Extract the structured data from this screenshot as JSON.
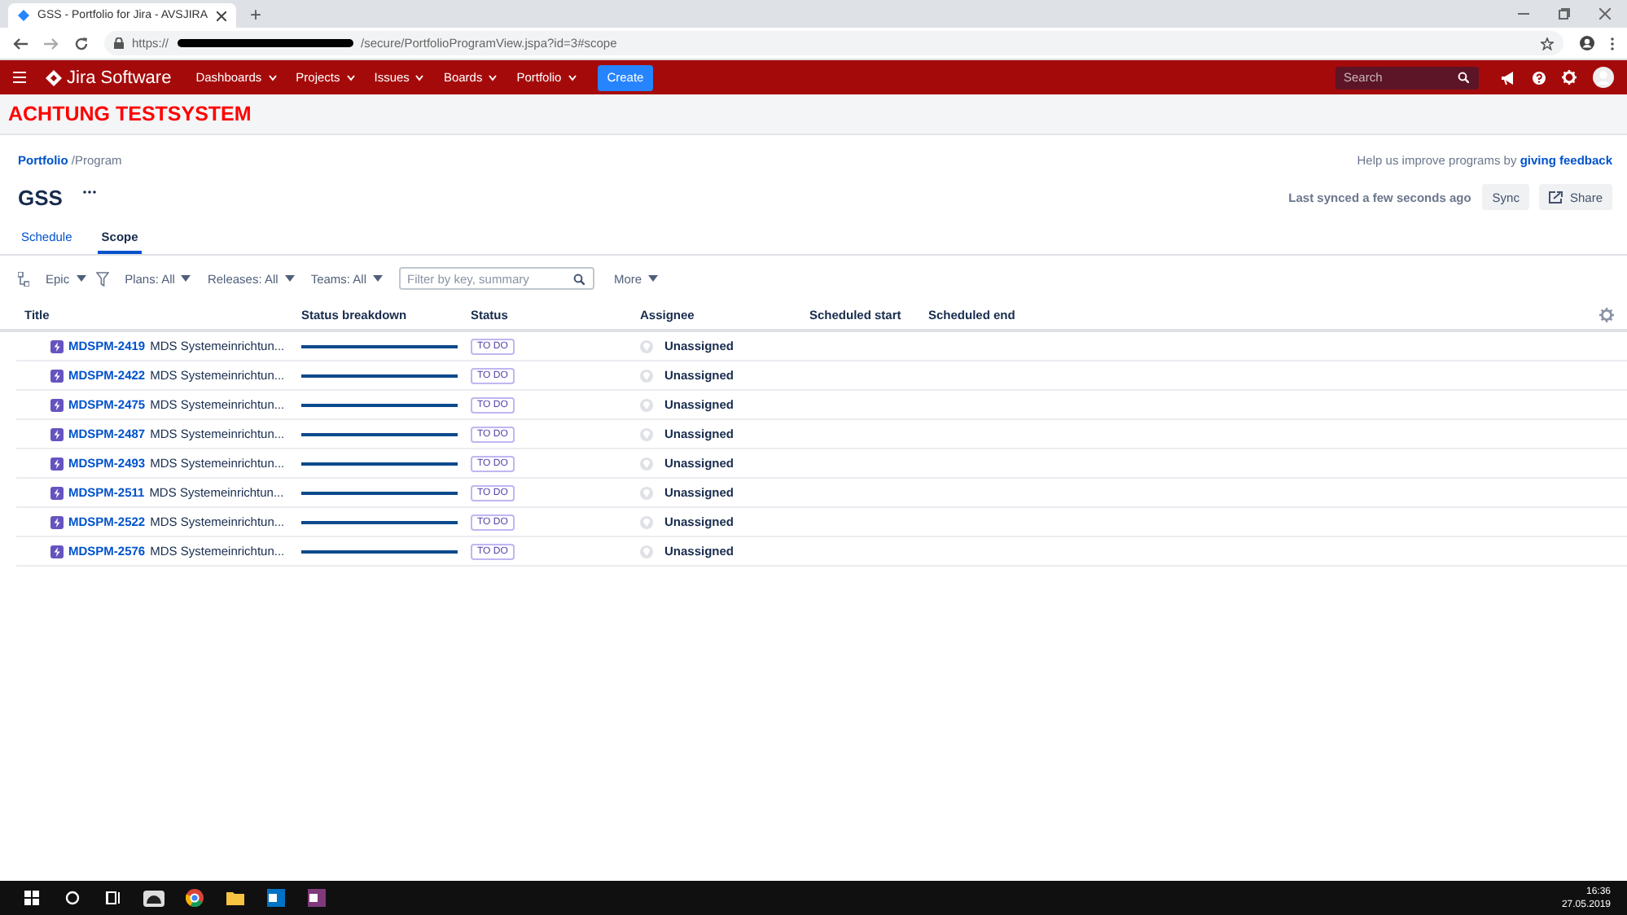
{
  "browser": {
    "tab_title": "GSS - Portfolio for Jira - AVSJIRA",
    "new_tab": "+",
    "url_start": "https://",
    "url_end": "/secure/PortfolioProgramView.jspa?id=3#scope"
  },
  "nav": {
    "product": "Jira Software",
    "menus": [
      "Dashboards",
      "Projects",
      "Issues",
      "Boards",
      "Portfolio"
    ],
    "create": "Create",
    "search": {
      "placeholder": "Search"
    }
  },
  "banner": "ACHTUNG TESTSYSTEM",
  "breadcrumb": {
    "link": "Portfolio",
    "current": "/Program"
  },
  "feedback": {
    "text": "Help us improve programs by",
    "link": "giving feedback"
  },
  "title": "GSS",
  "sync": {
    "status": "Last synced a few seconds ago",
    "sync_button": "Sync",
    "share_button": "Share"
  },
  "tabs": [
    {
      "label": "Schedule",
      "selected": false
    },
    {
      "label": "Scope",
      "selected": true
    }
  ],
  "filters": {
    "hierarchy": "Epic",
    "dropdowns": [
      "Plans: All",
      "Releases: All",
      "Teams: All"
    ],
    "search": {
      "placeholder": "Filter by key, summary"
    },
    "more": "More"
  },
  "table": {
    "columns": [
      "Title",
      "Status breakdown",
      "Status",
      "Assignee",
      "Scheduled start",
      "Scheduled end"
    ],
    "rows": [
      {
        "key": "MDSPM-2419",
        "summary": "MDS Systemeinrichtun...",
        "level": 1,
        "status": "TO DO",
        "assignee": "Unassigned"
      },
      {
        "key": "MDSPM-2422",
        "summary": "MDS Systemeinrichtun...",
        "level": 1,
        "status": "TO DO",
        "assignee": "Unassigned"
      },
      {
        "key": "MDSPM-2475",
        "summary": "MDS Systemeinrichtun...",
        "level": 1,
        "status": "TO DO",
        "assignee": "Unassigned"
      },
      {
        "key": "MDSPM-2487",
        "summary": "MDS Systemeinrichtun...",
        "level": 1,
        "status": "TO DO",
        "assignee": "Unassigned"
      },
      {
        "key": "MDSPM-2493",
        "summary": "MDS Systemeinrichtun...",
        "level": 1,
        "status": "TO DO",
        "assignee": "Unassigned"
      },
      {
        "key": "MDSPM-2511",
        "summary": "MDS Systemeinrichtun...",
        "level": 1,
        "status": "TO DO",
        "assignee": "Unassigned"
      },
      {
        "key": "MDSPM-2522",
        "summary": "MDS Systemeinrichtun...",
        "level": 1,
        "status": "TO DO",
        "assignee": "Unassigned"
      },
      {
        "key": "MDSPM-2576",
        "summary": "MDS Systemeinrichtun...",
        "level": 1,
        "status": "TO DO",
        "assignee": "Unassigned"
      }
    ]
  },
  "taskbar": {
    "time": "16:36",
    "date": "27.05.2019"
  }
}
